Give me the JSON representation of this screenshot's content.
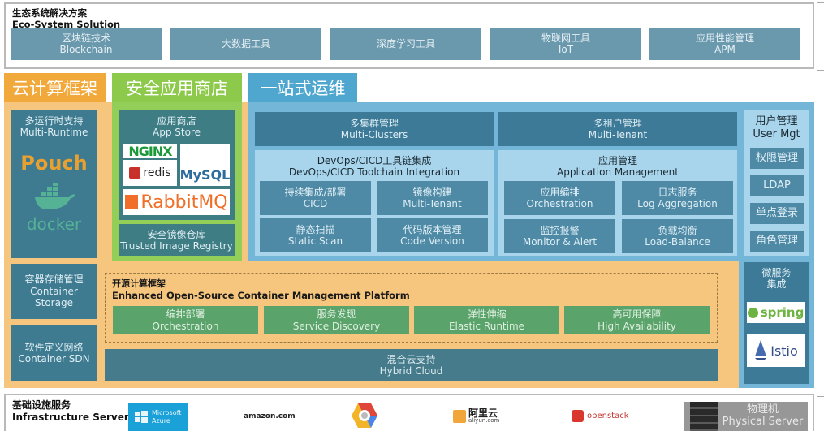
{
  "ecosystem": {
    "title_zh": "生态系统解决方案",
    "title_en": "Eco-System Solution",
    "items": [
      {
        "zh": "区块链技术",
        "en": "Blockchain"
      },
      {
        "zh": "大数据工具",
        "en": ""
      },
      {
        "zh": "深度学习工具",
        "en": ""
      },
      {
        "zh": "物联网工具",
        "en": "IoT"
      },
      {
        "zh": "应用性能管理",
        "en": "APM"
      }
    ]
  },
  "tabs": {
    "cloud": "云计算框架",
    "store": "安全应用商店",
    "ops": "一站式运维"
  },
  "cloud": {
    "runtime": {
      "zh": "多运行时支持",
      "en": "Multi-Runtime",
      "logos": [
        "Pouch",
        "docker"
      ]
    },
    "storage": {
      "zh": "容器存储管理",
      "en1": "Container",
      "en2": "Storage"
    },
    "sdn": {
      "zh": "软件定义网络",
      "en": "Container SDN"
    }
  },
  "store": {
    "appstore": {
      "zh": "应用商店",
      "en": "App Store",
      "logos": [
        "NGINX",
        "redis",
        "MySQL",
        "RabbitMQ"
      ]
    },
    "registry": {
      "zh": "安全镜像仓库",
      "en": "Trusted Image Registry"
    }
  },
  "ops": {
    "multi_clusters": {
      "zh": "多集群管理",
      "en": "Multi-Clusters"
    },
    "multi_tenant": {
      "zh": "多租户管理",
      "en": "Multi-Tenant"
    },
    "devops": {
      "zh": "DevOps/CICD工具链集成",
      "en": "DevOps/CICD Toolchain Integration",
      "cells": [
        {
          "zh": "持续集成/部署",
          "en": "CICD"
        },
        {
          "zh": "镜像构建",
          "en": "Multi-Tenant"
        },
        {
          "zh": "静态扫描",
          "en": "Static Scan"
        },
        {
          "zh": "代码版本管理",
          "en": "Code Version"
        }
      ]
    },
    "appmgmt": {
      "zh": "应用管理",
      "en": "Application Management",
      "cells": [
        {
          "zh": "应用编排",
          "en": "Orchestration"
        },
        {
          "zh": "日志服务",
          "en": "Log Aggregation"
        },
        {
          "zh": "监控报警",
          "en": "Monitor & Alert"
        },
        {
          "zh": "负载均衡",
          "en": "Load-Balance"
        }
      ]
    }
  },
  "user_mgt": {
    "zh": "用户管理",
    "en": "User Mgt",
    "items": [
      "权限管理",
      "LDAP",
      "单点登录",
      "角色管理"
    ]
  },
  "microservice": {
    "zh1": "微服务",
    "zh2": "集成",
    "logos": [
      "spring",
      "Istio"
    ]
  },
  "platform": {
    "title_zh": "开源计算框架",
    "title_en": "Enhanced Open-Source Container Management Platform",
    "items": [
      {
        "zh": "编排部署",
        "en": "Orchestration"
      },
      {
        "zh": "服务发现",
        "en": "Service Discovery"
      },
      {
        "zh": "弹性伸缩",
        "en": "Elastic Runtime"
      },
      {
        "zh": "高可用保障",
        "en": "High Availability"
      }
    ]
  },
  "hybrid": {
    "zh": "混合云支持",
    "en": "Hybrid Cloud"
  },
  "infra": {
    "title_zh": "基础设施服务",
    "title_en": "Infrastructure Server",
    "providers": {
      "azure": {
        "line1": "Microsoft",
        "line2": "Azure"
      },
      "amazon": "amazon.com",
      "aliyun": {
        "zh": "阿里云",
        "en": "aliyun.com"
      },
      "openstack": "openstack",
      "physical": {
        "zh": "物理机",
        "en": "Physical Server"
      }
    }
  }
}
